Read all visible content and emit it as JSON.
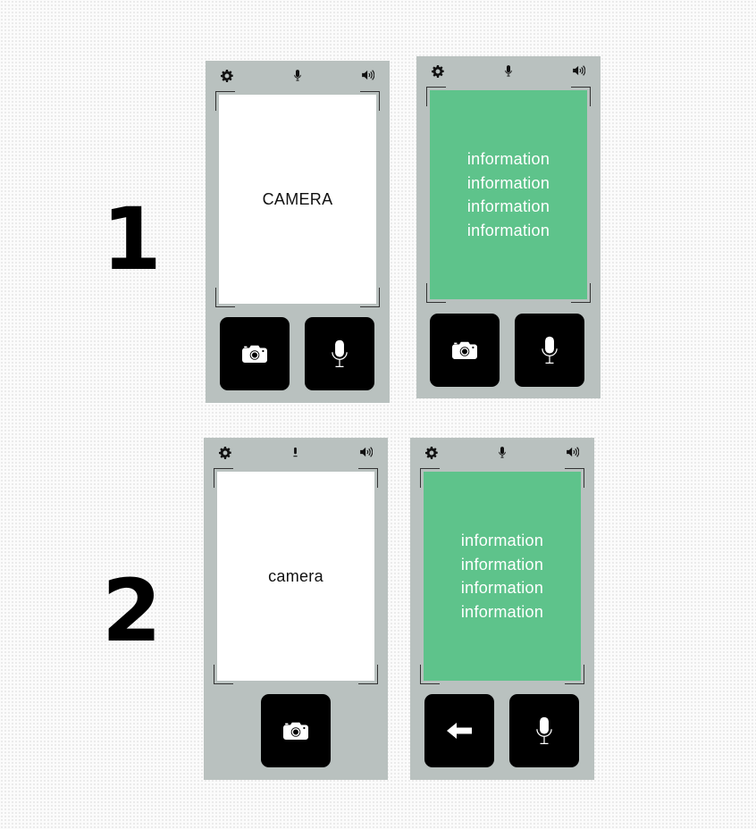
{
  "rows": [
    {
      "label": "1"
    },
    {
      "label": "2"
    }
  ],
  "phones": [
    {
      "screen_text": "CAMERA",
      "status_icons": [
        "gear-icon",
        "microphone-icon",
        "speaker-icon"
      ],
      "buttons": [
        "camera-icon",
        "microphone-icon"
      ]
    },
    {
      "screen_lines": [
        "information",
        "information",
        "information",
        "information"
      ],
      "status_icons": [
        "gear-icon",
        "microphone-icon",
        "speaker-icon"
      ],
      "buttons": [
        "camera-icon",
        "microphone-icon"
      ]
    },
    {
      "screen_text": "camera",
      "status_icons": [
        "gear-icon",
        "exclamation-icon",
        "speaker-icon"
      ],
      "buttons": [
        "camera-icon"
      ]
    },
    {
      "screen_lines": [
        "information",
        "information",
        "information",
        "information"
      ],
      "status_icons": [
        "gear-icon",
        "microphone-icon",
        "speaker-icon"
      ],
      "buttons": [
        "back-arrow-icon",
        "microphone-icon"
      ]
    }
  ],
  "colors": {
    "phone_body": "#b9c1bf",
    "info_screen": "#5ec38b",
    "camera_screen": "#ffffff",
    "button": "#000000"
  }
}
